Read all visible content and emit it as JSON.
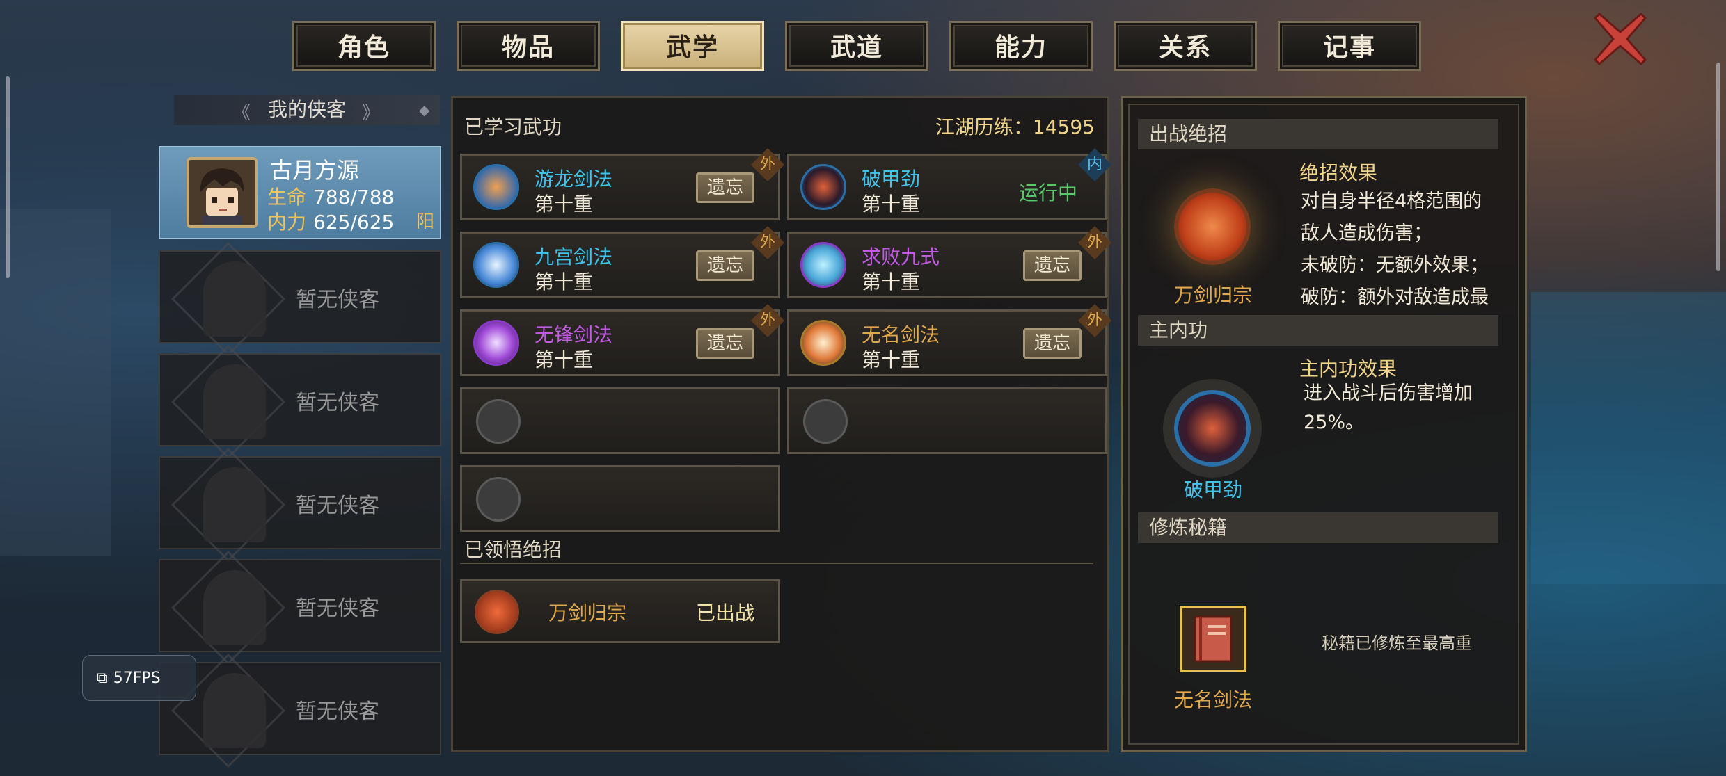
{
  "tabs": [
    "角色",
    "物品",
    "武学",
    "武道",
    "能力",
    "关系",
    "记事"
  ],
  "active_tab": "武学",
  "left": {
    "header": "我的侠客",
    "character": {
      "name": "古月方源",
      "hp_label": "生命",
      "hp_value": "788/788",
      "mp_label": "内力",
      "mp_value": "625/625",
      "attribute": "阳"
    },
    "empty_slots": [
      "暂无侠客",
      "暂无侠客",
      "暂无侠客",
      "暂无侠客",
      "暂无侠客"
    ]
  },
  "fps": "57FPS",
  "middle": {
    "title": "已学习武功",
    "experience": "江湖历练：14595",
    "skills": [
      {
        "name": "游龙剑法",
        "level": "第十重",
        "action": "遗忘",
        "tag": "外",
        "color": "#3fc3ea"
      },
      {
        "name": "破甲劲",
        "level": "第十重",
        "action": "运行中",
        "tag": "内",
        "color": "#3fc3ea"
      },
      {
        "name": "九宫剑法",
        "level": "第十重",
        "action": "遗忘",
        "tag": "外",
        "color": "#3fc3ea"
      },
      {
        "name": "求败九式",
        "level": "第十重",
        "action": "遗忘",
        "tag": "外",
        "color": "#c25ae6"
      },
      {
        "name": "无锋剑法",
        "level": "第十重",
        "action": "遗忘",
        "tag": "外",
        "color": "#c25ae6"
      },
      {
        "name": "无名剑法",
        "level": "第十重",
        "action": "遗忘",
        "tag": "外",
        "color": "#e0a84a"
      }
    ],
    "ult_title": "已领悟绝招",
    "ult": {
      "name": "万剑归宗",
      "status": "已出战"
    }
  },
  "right": {
    "ult_section": "出战绝招",
    "ult_name": "万剑归宗",
    "ult_effect_title": "绝招效果",
    "ult_effect_lines": [
      "对自身半径4格范围的",
      "敌人造成伤害；",
      "未破防：无额外效果；",
      "破防：额外对敌造成最"
    ],
    "inner_section": "主内功",
    "inner_name": "破甲劲",
    "inner_effect_title": "主内功效果",
    "inner_effect_lines": [
      "进入战斗后伤害增加",
      "25%。"
    ],
    "book_section": "修炼秘籍",
    "book_name": "无名剑法",
    "book_status": "秘籍已修炼至最高重"
  }
}
